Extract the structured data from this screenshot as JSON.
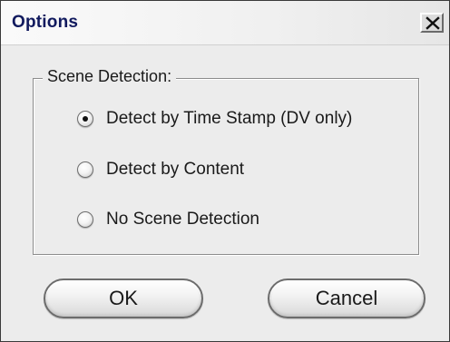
{
  "window": {
    "title": "Options",
    "close_icon": "close-icon"
  },
  "scene_detection": {
    "group_label": "Scene Detection:",
    "selected": "Detect by Time Stamp (DV only)",
    "options": [
      {
        "label": "Detect by Time Stamp (DV only)",
        "checked": true
      },
      {
        "label": "Detect by Content",
        "checked": false
      },
      {
        "label": "No Scene Detection",
        "checked": false
      }
    ]
  },
  "buttons": {
    "ok_label": "OK",
    "cancel_label": "Cancel"
  },
  "colors": {
    "title_text": "#111a5e",
    "dialog_bg": "#ececec"
  }
}
